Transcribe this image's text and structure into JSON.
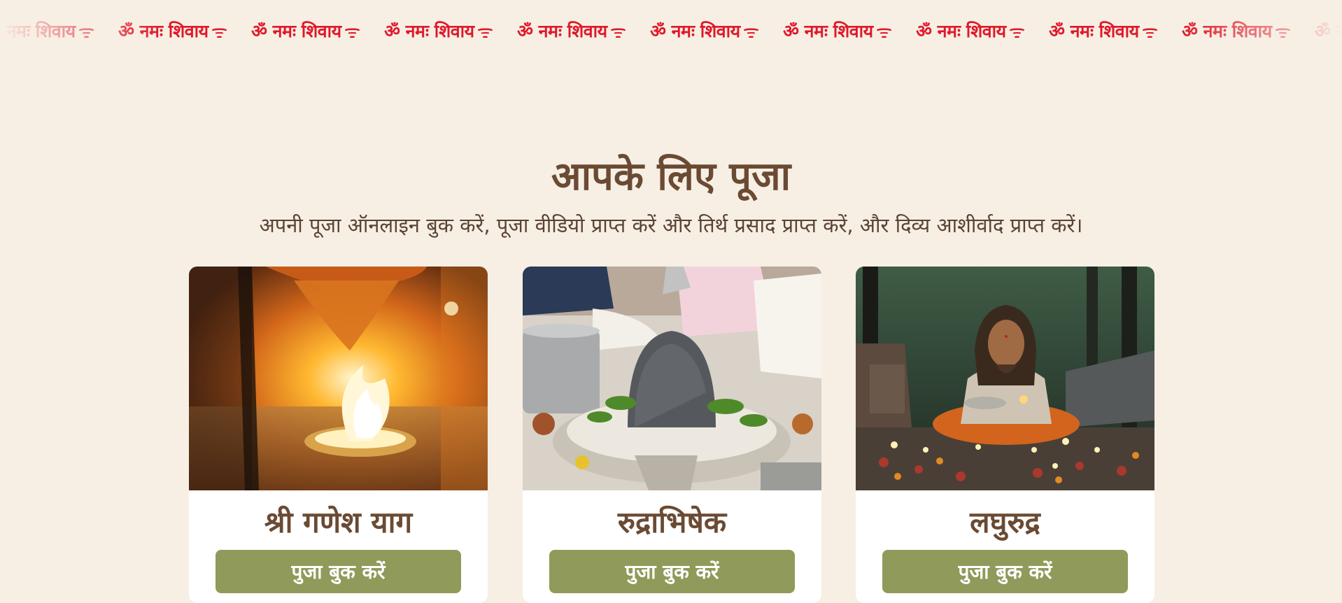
{
  "marquee": {
    "chant": "ॐ नमः शिवाय",
    "items": [
      "ॐ नमः शिवाय",
      "ॐ नमः शिवाय",
      "ॐ नमः शिवाय",
      "ॐ नमः शिवाय",
      "ॐ नमः शिवाय",
      "ॐ नमः शिवाय",
      "ॐ नमः शिवाय",
      "ॐ नमः शिवाय",
      "ॐ नमः शिवाय",
      "ॐ नमः शिवाय",
      "ॐ नमः शिवाय"
    ],
    "color": "#e0182a"
  },
  "section": {
    "title": "आपके लिए पूजा",
    "subtitle": "अपनी पूजा ऑनलाइन बुक करें, पूजा वीडियो प्राप्त करें और तिर्थ प्रसाद प्राप्त करें, और दिव्य आशीर्वाद प्राप्त करें।"
  },
  "cards": [
    {
      "title": "श्री गणेश याग",
      "button": "पुजा बुक करें",
      "image": "havan-fire-ritual"
    },
    {
      "title": "रुद्राभिषेक",
      "button": "पुजा बुक करें",
      "image": "shivling-abhishek"
    },
    {
      "title": "लघुरुद्र",
      "button": "पुजा बुक करें",
      "image": "sadhu-lamp-puja"
    }
  ],
  "colors": {
    "background": "#f7efe4",
    "heading": "#6b4a33",
    "button": "#909a5a",
    "chant": "#e0182a"
  }
}
